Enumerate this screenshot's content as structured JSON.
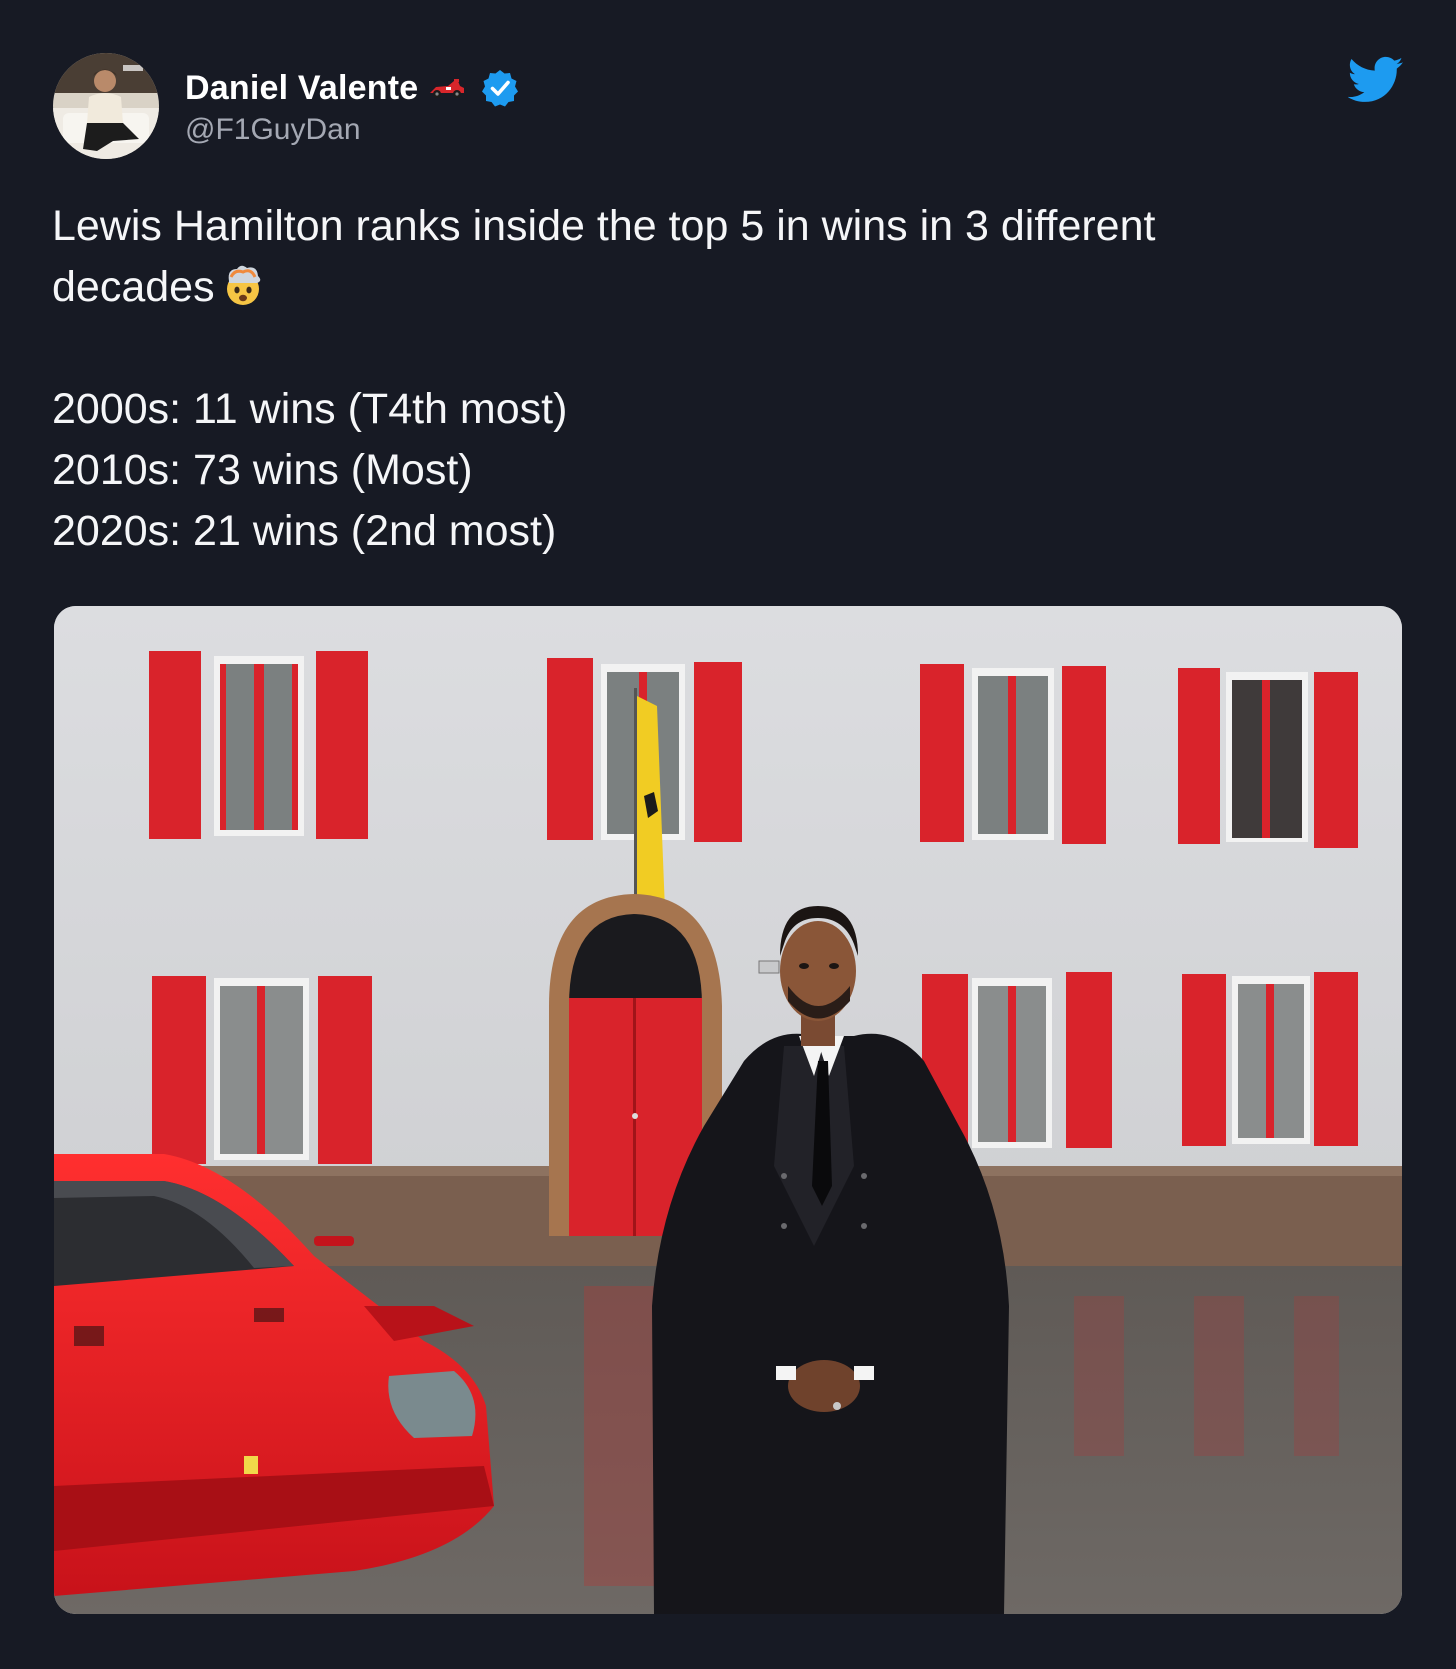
{
  "author": {
    "display_name": "Daniel Valente",
    "handle": "@F1GuyDan",
    "name_emoji": "racing-car-emoji",
    "verified": true
  },
  "platform_icon": "twitter-bird-icon",
  "tweet": {
    "line1": "Lewis Hamilton ranks inside the top 5 in wins in 3 different",
    "line2": "decades",
    "line2_emoji": "exploding-head-emoji",
    "stats": [
      "2000s: 11 wins (T4th most)",
      "2010s: 73 wins (Most)",
      "2020s: 21 wins (2nd most)"
    ]
  },
  "colors": {
    "background": "#171a24",
    "text": "#f5f6f8",
    "handle": "#a4a8b3",
    "verified": "#1d9bf0",
    "twitter_blue": "#1d9bf0"
  },
  "media": {
    "type": "photo"
  }
}
